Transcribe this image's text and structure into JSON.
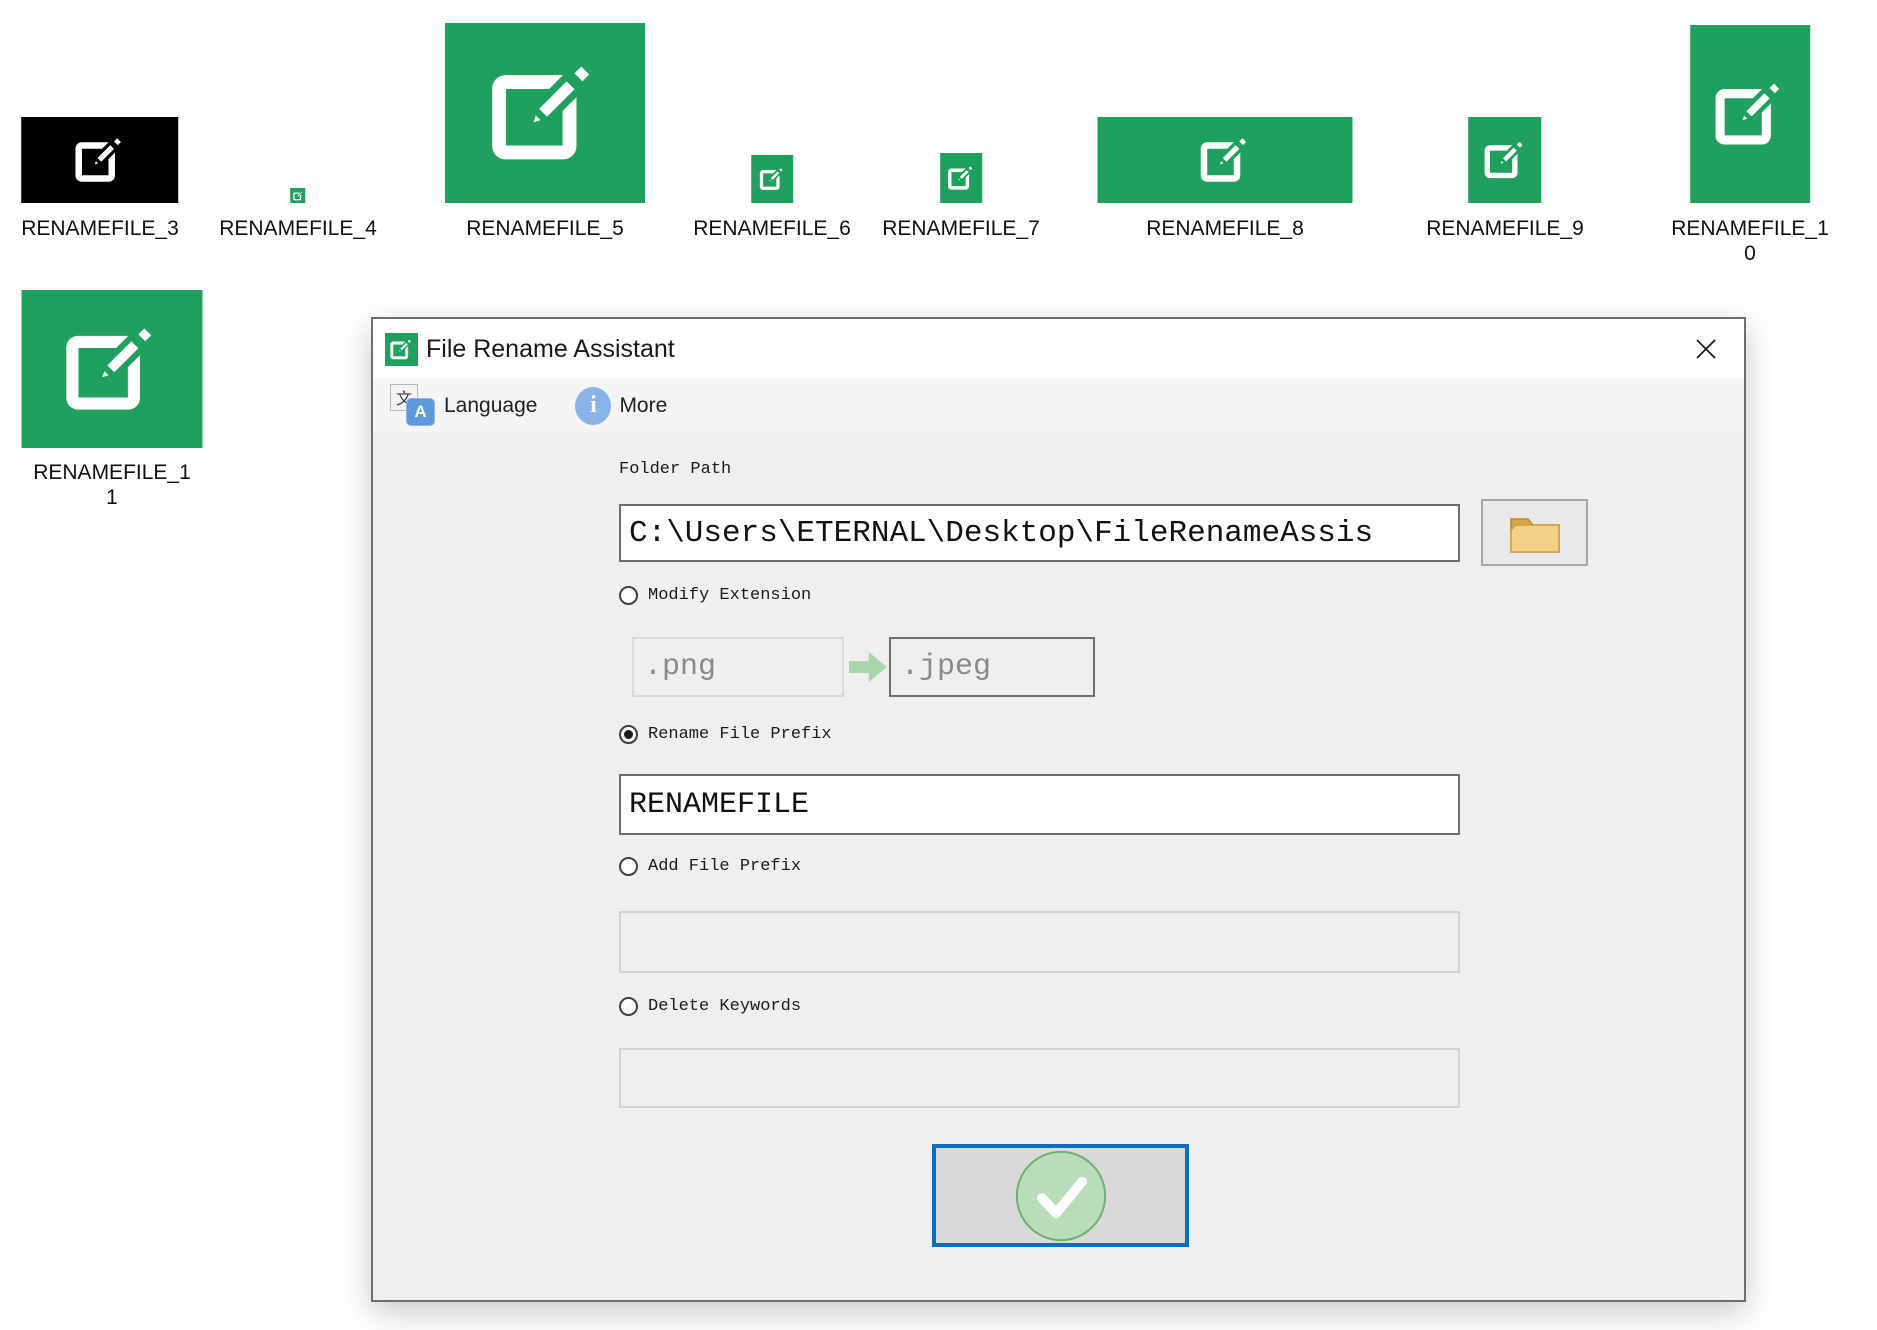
{
  "desktop": {
    "files": [
      {
        "label": "RENAMEFILE_3",
        "color": "#000000"
      },
      {
        "label": "RENAMEFILE_4",
        "color": "#1fa05f"
      },
      {
        "label": "RENAMEFILE_5",
        "color": "#1fa05f"
      },
      {
        "label": "RENAMEFILE_6",
        "color": "#1fa05f"
      },
      {
        "label": "RENAMEFILE_7",
        "color": "#1fa05f"
      },
      {
        "label": "RENAMEFILE_8",
        "color": "#1fa05f"
      },
      {
        "label": "RENAMEFILE_9",
        "color": "#1fa05f"
      },
      {
        "label": "RENAMEFILE_1\n0",
        "color": "#1fa05f"
      },
      {
        "label": "RENAMEFILE_1\n1",
        "color": "#1fa05f"
      }
    ]
  },
  "dialog": {
    "title": "File Rename Assistant",
    "close_glyph": "✕",
    "menu": {
      "language": "Language",
      "more": "More",
      "info_glyph": "i",
      "translate_back_glyph": "文",
      "translate_front_glyph": "A"
    },
    "form": {
      "folder_path_label": "Folder Path",
      "folder_path_value": "C:\\Users\\ETERNAL\\Desktop\\FileRenameAssis",
      "options": [
        {
          "label": "Modify Extension",
          "selected": false
        },
        {
          "label": "Rename File Prefix",
          "selected": true
        },
        {
          "label": "Add File Prefix",
          "selected": false
        },
        {
          "label": "Delete Keywords",
          "selected": false
        }
      ],
      "extension_from": ".png",
      "extension_to": ".jpeg",
      "rename_prefix_value": "RENAMEFILE",
      "add_prefix_value": "",
      "delete_keywords_value": ""
    },
    "icons": [
      "edit-pencil-square-icon",
      "translate-icon",
      "info-icon",
      "close-icon",
      "folder-icon",
      "green-arrow-right-icon",
      "check-circle-icon"
    ],
    "colors": {
      "icon_green": "#1fa05f",
      "confirm_border_blue": "#0d6ebe",
      "check_circle_fill": "#b9dcb9",
      "info_blue": "#8ab4e8",
      "folder_tan": "#f2d187"
    }
  }
}
